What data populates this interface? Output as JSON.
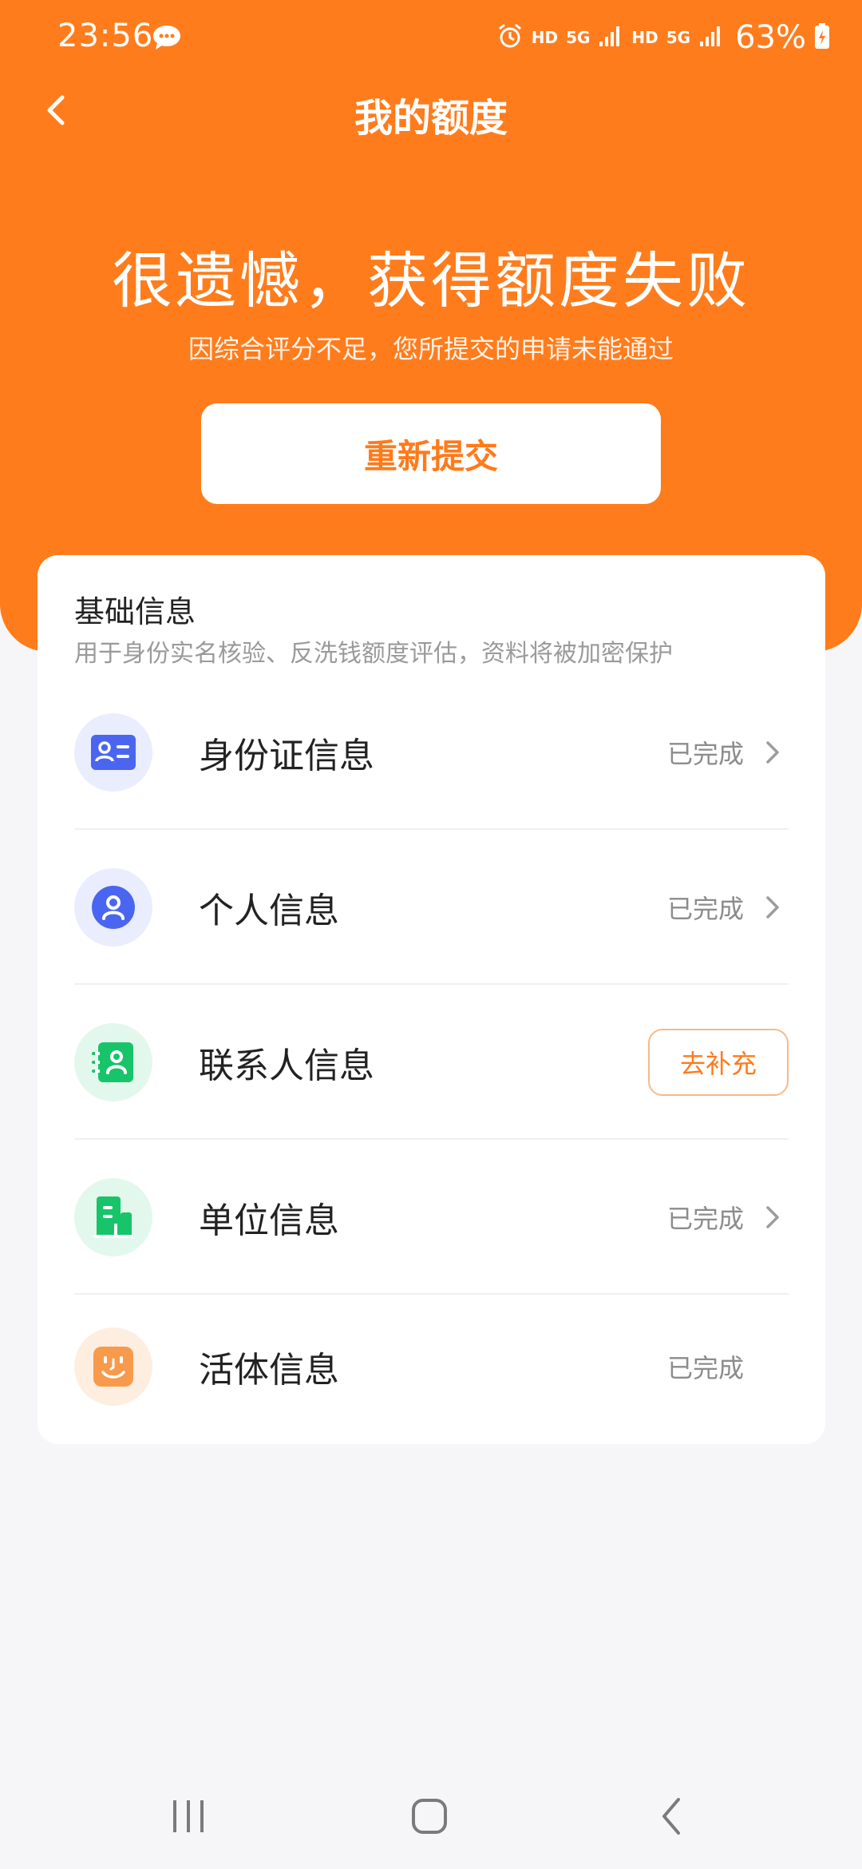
{
  "status_bar": {
    "time": "23:56",
    "hd_1": "HD",
    "net_1": "5G",
    "hd_2": "HD",
    "net_2": "5G",
    "battery": "63%"
  },
  "nav": {
    "title": "我的额度"
  },
  "result": {
    "title": "很遗憾，获得额度失败",
    "subtitle": "因综合评分不足，您所提交的申请未能通过",
    "resubmit_label": "重新提交"
  },
  "info_card": {
    "title": "基础信息",
    "description": "用于身份实名核验、反洗钱额度评估，资料将被加密保护",
    "items": [
      {
        "label": "身份证信息",
        "status": "已完成",
        "icon": "id-card-icon"
      },
      {
        "label": "个人信息",
        "status": "已完成",
        "icon": "person-icon"
      },
      {
        "label": "联系人信息",
        "action": "去补充",
        "icon": "contact-book-icon"
      },
      {
        "label": "单位信息",
        "status": "已完成",
        "icon": "building-icon"
      },
      {
        "label": "活体信息",
        "status": "已完成",
        "icon": "face-icon"
      }
    ]
  },
  "colors": {
    "brand_orange": "#ff7c1c",
    "button_text_orange": "#ff7a1a",
    "icon_blue": "#4a66f0",
    "icon_green": "#18c46a",
    "icon_orange": "#f89a4c"
  }
}
